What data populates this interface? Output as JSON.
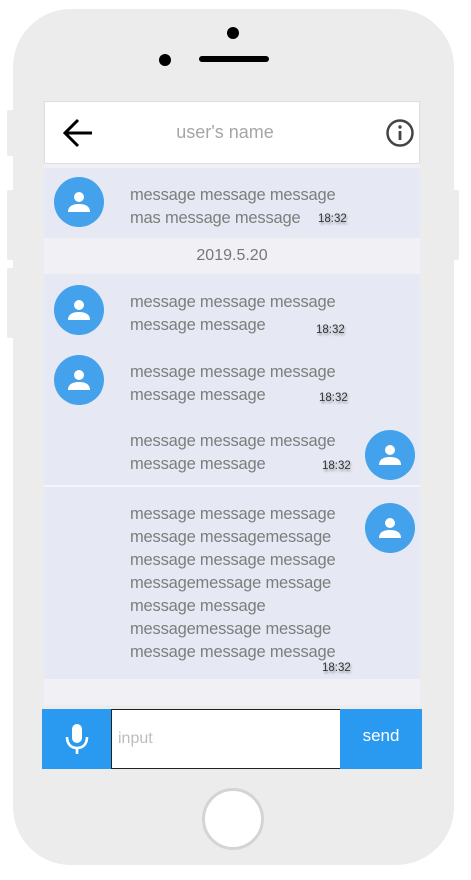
{
  "header": {
    "title": "user's name",
    "back_icon": "arrow-left-icon",
    "info_icon": "info-circle-icon"
  },
  "messages": [
    {
      "text": "message message message\nmas message message",
      "time": "18:32",
      "sender": "other"
    },
    {
      "text": "message message message\nmessage message",
      "time": "18:32",
      "sender": "other"
    },
    {
      "text": "message message message\nmessage message",
      "time": "18:32",
      "sender": "other"
    },
    {
      "text": "message message message\nmessage message",
      "time": "18:32",
      "sender": "self"
    },
    {
      "text": "message message message\nmessage messagemessage\nmessage message message\nmessagemessage message\nmessage message\nmessagemessage message\nmessage message message",
      "time": "18:32",
      "sender": "self"
    }
  ],
  "date_separator": "2019.5.20",
  "input_bar": {
    "placeholder": "input",
    "value": "",
    "send_label": "send",
    "mic_icon": "microphone-icon"
  },
  "colors": {
    "accent": "#2a9af0",
    "avatar": "#44a1ec",
    "message_bg": "#e6e9f4",
    "screen_bg": "#f1f0f5",
    "phone_body": "#ececec"
  }
}
